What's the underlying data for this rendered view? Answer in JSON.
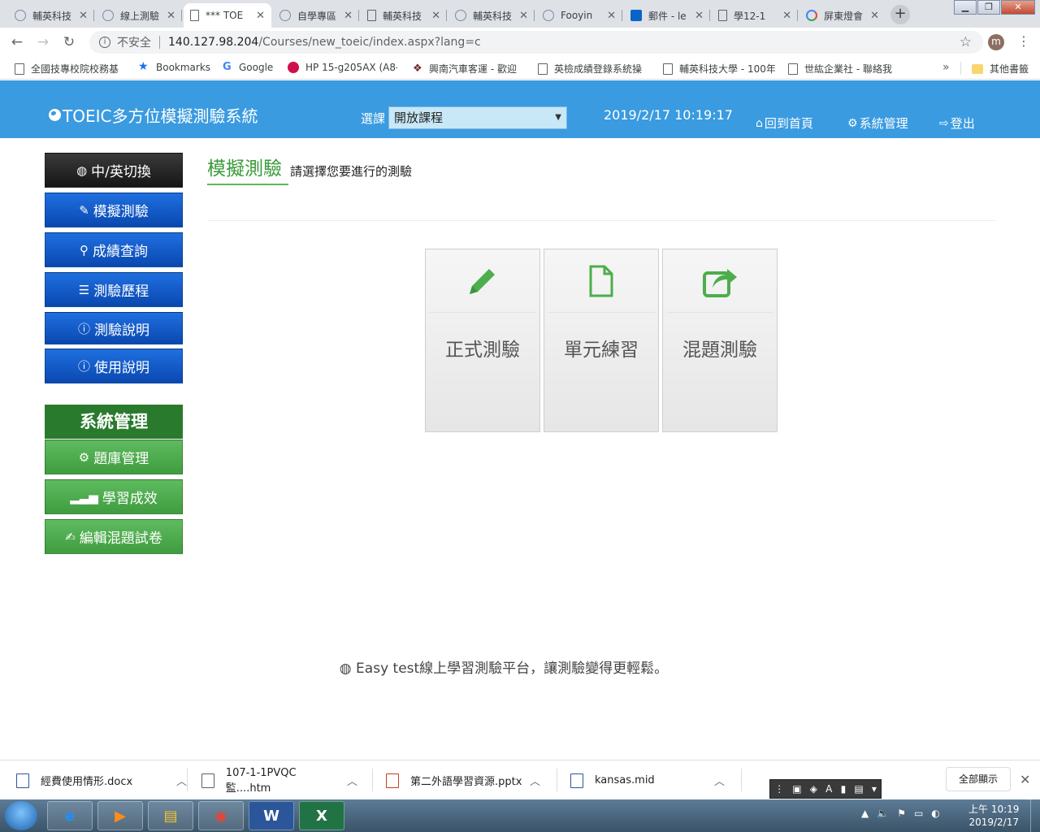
{
  "browser": {
    "tabs": [
      {
        "title": "輔英科技",
        "icon": "globe-icon"
      },
      {
        "title": "線上測驗",
        "icon": "globe-icon"
      },
      {
        "title": "*** TOE",
        "icon": "doc-icon",
        "active": true
      },
      {
        "title": "自學專區",
        "icon": "globe-icon"
      },
      {
        "title": "輔英科技",
        "icon": "doc-icon"
      },
      {
        "title": "輔英科技",
        "icon": "globe-icon"
      },
      {
        "title": "Fooyin",
        "icon": "globe-icon"
      },
      {
        "title": "郵件 - le",
        "icon": "outlook-icon"
      },
      {
        "title": "學12-1",
        "icon": "doc-icon"
      },
      {
        "title": "屏東燈會",
        "icon": "google-icon"
      }
    ],
    "tab_close": "✕",
    "new_tab": "+",
    "address": {
      "security_label": "不安全",
      "host": "140.127.98.204",
      "path": "/Courses/new_toeic/index.aspx?lang=c"
    },
    "profile_initial": "m",
    "bookmarks": [
      {
        "label": "全國技專校院校務基",
        "icon": "doc-icon"
      },
      {
        "label": "Bookmarks",
        "icon": "star-icon"
      },
      {
        "label": "Google",
        "icon": "google-icon"
      },
      {
        "label": "HP 15-g205AX (A8-",
        "icon": "hp-icon"
      },
      {
        "label": "興南汽車客運 - 歡迎",
        "icon": "bus-icon"
      },
      {
        "label": "英檢成績登錄系統操",
        "icon": "doc-icon"
      },
      {
        "label": "輔英科技大學 - 100年",
        "icon": "doc-icon"
      },
      {
        "label": "世紘企業社 - 聯絡我",
        "icon": "doc-icon"
      }
    ],
    "bookmarks_more": "»",
    "other_bookmarks": "其他書籤"
  },
  "header": {
    "brand": "TOEIC多方位模擬測驗系統",
    "course_label": "選課",
    "course_selected": "開放課程",
    "datetime": "2019/2/17 10:19:17",
    "nav": [
      {
        "label": "回到首頁",
        "icon": "home-icon"
      },
      {
        "label": "系統管理",
        "icon": "gear-icon"
      },
      {
        "label": "登出",
        "icon": "logout-icon"
      }
    ]
  },
  "sidebar": {
    "items": [
      {
        "label": "中/英切換",
        "icon": "globe-icon"
      },
      {
        "label": "模擬測驗",
        "icon": "pencil-icon"
      },
      {
        "label": "成績查詢",
        "icon": "search-icon"
      },
      {
        "label": "測驗歷程",
        "icon": "list-icon"
      },
      {
        "label": "測驗說明",
        "icon": "info-icon"
      },
      {
        "label": "使用說明",
        "icon": "info-icon"
      }
    ],
    "admin_title": "系統管理",
    "admin_items": [
      {
        "label": "題庫管理",
        "icon": "gear-icon"
      },
      {
        "label": "學習成效",
        "icon": "signal-icon"
      },
      {
        "label": "編輯混題試卷",
        "icon": "edit-icon"
      }
    ]
  },
  "main": {
    "title": "模擬測驗",
    "subtitle": "請選擇您要進行的測驗",
    "cards": [
      {
        "label": "正式測驗",
        "icon": "pencil-icon"
      },
      {
        "label": "單元練習",
        "icon": "file-icon"
      },
      {
        "label": "混題測驗",
        "icon": "share-icon"
      }
    ]
  },
  "footer": {
    "text": "Easy test線上學習測驗平台，讓測驗變得更輕鬆。"
  },
  "downloads": {
    "items": [
      {
        "name": "經費使用情形.docx",
        "type": "docx"
      },
      {
        "name": "107-1-1PVQC監....htm",
        "type": "htm"
      },
      {
        "name": "第二外語學習資源.pptx",
        "type": "pptx"
      },
      {
        "name": "kansas.mid",
        "type": "mid"
      }
    ],
    "show_all": "全部顯示",
    "close": "✕"
  },
  "taskbar": {
    "apps": [
      "e",
      "▶",
      "▤",
      "◉",
      "W",
      "X"
    ],
    "time": "上午 10:19",
    "date": "2019/2/17"
  },
  "colors": {
    "header_bg": "#3a9be0",
    "blue_btn": "#0a48b0",
    "green_btn": "#4cae4c",
    "admin_head": "#2a7a2e"
  }
}
